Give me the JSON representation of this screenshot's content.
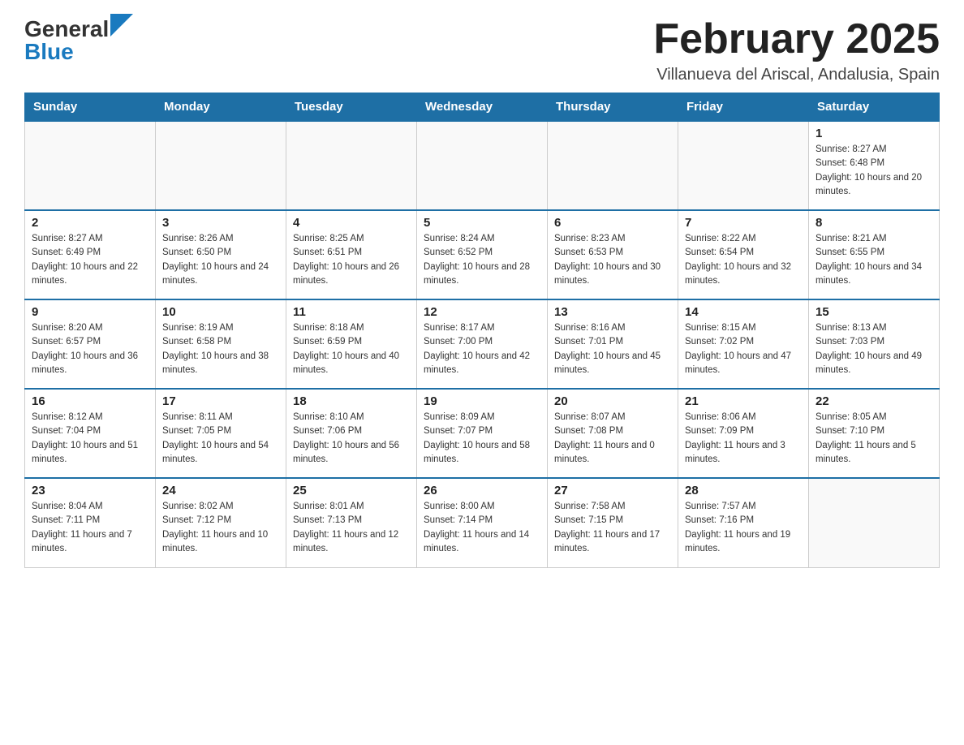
{
  "header": {
    "logo_general": "General",
    "logo_blue": "Blue",
    "title": "February 2025",
    "subtitle": "Villanueva del Ariscal, Andalusia, Spain"
  },
  "days_of_week": [
    "Sunday",
    "Monday",
    "Tuesday",
    "Wednesday",
    "Thursday",
    "Friday",
    "Saturday"
  ],
  "weeks": [
    [
      {
        "day": "",
        "sunrise": "",
        "sunset": "",
        "daylight": ""
      },
      {
        "day": "",
        "sunrise": "",
        "sunset": "",
        "daylight": ""
      },
      {
        "day": "",
        "sunrise": "",
        "sunset": "",
        "daylight": ""
      },
      {
        "day": "",
        "sunrise": "",
        "sunset": "",
        "daylight": ""
      },
      {
        "day": "",
        "sunrise": "",
        "sunset": "",
        "daylight": ""
      },
      {
        "day": "",
        "sunrise": "",
        "sunset": "",
        "daylight": ""
      },
      {
        "day": "1",
        "sunrise": "Sunrise: 8:27 AM",
        "sunset": "Sunset: 6:48 PM",
        "daylight": "Daylight: 10 hours and 20 minutes."
      }
    ],
    [
      {
        "day": "2",
        "sunrise": "Sunrise: 8:27 AM",
        "sunset": "Sunset: 6:49 PM",
        "daylight": "Daylight: 10 hours and 22 minutes."
      },
      {
        "day": "3",
        "sunrise": "Sunrise: 8:26 AM",
        "sunset": "Sunset: 6:50 PM",
        "daylight": "Daylight: 10 hours and 24 minutes."
      },
      {
        "day": "4",
        "sunrise": "Sunrise: 8:25 AM",
        "sunset": "Sunset: 6:51 PM",
        "daylight": "Daylight: 10 hours and 26 minutes."
      },
      {
        "day": "5",
        "sunrise": "Sunrise: 8:24 AM",
        "sunset": "Sunset: 6:52 PM",
        "daylight": "Daylight: 10 hours and 28 minutes."
      },
      {
        "day": "6",
        "sunrise": "Sunrise: 8:23 AM",
        "sunset": "Sunset: 6:53 PM",
        "daylight": "Daylight: 10 hours and 30 minutes."
      },
      {
        "day": "7",
        "sunrise": "Sunrise: 8:22 AM",
        "sunset": "Sunset: 6:54 PM",
        "daylight": "Daylight: 10 hours and 32 minutes."
      },
      {
        "day": "8",
        "sunrise": "Sunrise: 8:21 AM",
        "sunset": "Sunset: 6:55 PM",
        "daylight": "Daylight: 10 hours and 34 minutes."
      }
    ],
    [
      {
        "day": "9",
        "sunrise": "Sunrise: 8:20 AM",
        "sunset": "Sunset: 6:57 PM",
        "daylight": "Daylight: 10 hours and 36 minutes."
      },
      {
        "day": "10",
        "sunrise": "Sunrise: 8:19 AM",
        "sunset": "Sunset: 6:58 PM",
        "daylight": "Daylight: 10 hours and 38 minutes."
      },
      {
        "day": "11",
        "sunrise": "Sunrise: 8:18 AM",
        "sunset": "Sunset: 6:59 PM",
        "daylight": "Daylight: 10 hours and 40 minutes."
      },
      {
        "day": "12",
        "sunrise": "Sunrise: 8:17 AM",
        "sunset": "Sunset: 7:00 PM",
        "daylight": "Daylight: 10 hours and 42 minutes."
      },
      {
        "day": "13",
        "sunrise": "Sunrise: 8:16 AM",
        "sunset": "Sunset: 7:01 PM",
        "daylight": "Daylight: 10 hours and 45 minutes."
      },
      {
        "day": "14",
        "sunrise": "Sunrise: 8:15 AM",
        "sunset": "Sunset: 7:02 PM",
        "daylight": "Daylight: 10 hours and 47 minutes."
      },
      {
        "day": "15",
        "sunrise": "Sunrise: 8:13 AM",
        "sunset": "Sunset: 7:03 PM",
        "daylight": "Daylight: 10 hours and 49 minutes."
      }
    ],
    [
      {
        "day": "16",
        "sunrise": "Sunrise: 8:12 AM",
        "sunset": "Sunset: 7:04 PM",
        "daylight": "Daylight: 10 hours and 51 minutes."
      },
      {
        "day": "17",
        "sunrise": "Sunrise: 8:11 AM",
        "sunset": "Sunset: 7:05 PM",
        "daylight": "Daylight: 10 hours and 54 minutes."
      },
      {
        "day": "18",
        "sunrise": "Sunrise: 8:10 AM",
        "sunset": "Sunset: 7:06 PM",
        "daylight": "Daylight: 10 hours and 56 minutes."
      },
      {
        "day": "19",
        "sunrise": "Sunrise: 8:09 AM",
        "sunset": "Sunset: 7:07 PM",
        "daylight": "Daylight: 10 hours and 58 minutes."
      },
      {
        "day": "20",
        "sunrise": "Sunrise: 8:07 AM",
        "sunset": "Sunset: 7:08 PM",
        "daylight": "Daylight: 11 hours and 0 minutes."
      },
      {
        "day": "21",
        "sunrise": "Sunrise: 8:06 AM",
        "sunset": "Sunset: 7:09 PM",
        "daylight": "Daylight: 11 hours and 3 minutes."
      },
      {
        "day": "22",
        "sunrise": "Sunrise: 8:05 AM",
        "sunset": "Sunset: 7:10 PM",
        "daylight": "Daylight: 11 hours and 5 minutes."
      }
    ],
    [
      {
        "day": "23",
        "sunrise": "Sunrise: 8:04 AM",
        "sunset": "Sunset: 7:11 PM",
        "daylight": "Daylight: 11 hours and 7 minutes."
      },
      {
        "day": "24",
        "sunrise": "Sunrise: 8:02 AM",
        "sunset": "Sunset: 7:12 PM",
        "daylight": "Daylight: 11 hours and 10 minutes."
      },
      {
        "day": "25",
        "sunrise": "Sunrise: 8:01 AM",
        "sunset": "Sunset: 7:13 PM",
        "daylight": "Daylight: 11 hours and 12 minutes."
      },
      {
        "day": "26",
        "sunrise": "Sunrise: 8:00 AM",
        "sunset": "Sunset: 7:14 PM",
        "daylight": "Daylight: 11 hours and 14 minutes."
      },
      {
        "day": "27",
        "sunrise": "Sunrise: 7:58 AM",
        "sunset": "Sunset: 7:15 PM",
        "daylight": "Daylight: 11 hours and 17 minutes."
      },
      {
        "day": "28",
        "sunrise": "Sunrise: 7:57 AM",
        "sunset": "Sunset: 7:16 PM",
        "daylight": "Daylight: 11 hours and 19 minutes."
      },
      {
        "day": "",
        "sunrise": "",
        "sunset": "",
        "daylight": ""
      }
    ]
  ]
}
